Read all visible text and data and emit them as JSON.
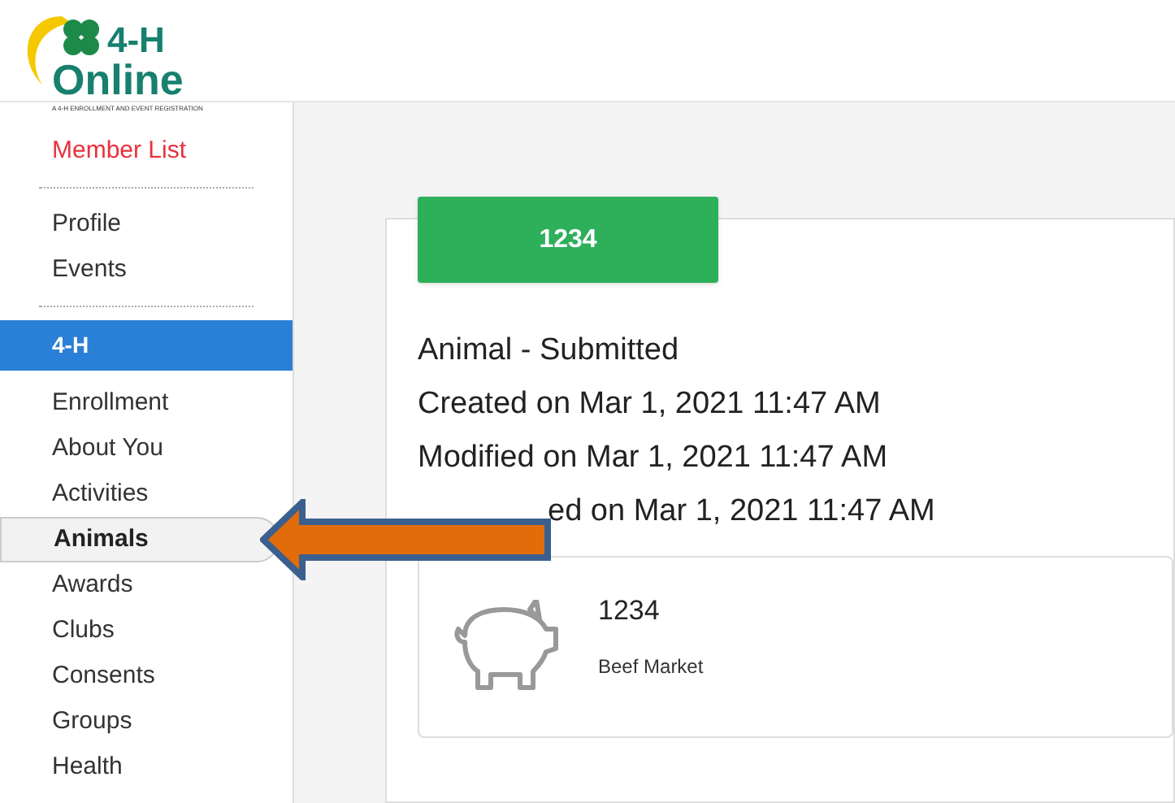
{
  "logo": {
    "line1": "4-H",
    "line2": "Online",
    "tagline": "A 4-H ENROLLMENT AND EVENT REGISTRATION"
  },
  "sidebar": {
    "items": [
      {
        "kind": "link",
        "label": "Member List",
        "selected": false
      },
      {
        "kind": "divider"
      },
      {
        "kind": "item",
        "label": "Profile",
        "selected": false
      },
      {
        "kind": "item",
        "label": "Events",
        "selected": false
      },
      {
        "kind": "divider"
      },
      {
        "kind": "header",
        "label": "4-H"
      },
      {
        "kind": "item",
        "label": "Enrollment",
        "selected": false
      },
      {
        "kind": "item",
        "label": "About You",
        "selected": false
      },
      {
        "kind": "item",
        "label": "Activities",
        "selected": false
      },
      {
        "kind": "item",
        "label": "Animals",
        "selected": true
      },
      {
        "kind": "item",
        "label": "Awards",
        "selected": false
      },
      {
        "kind": "item",
        "label": "Clubs",
        "selected": false
      },
      {
        "kind": "item",
        "label": "Consents",
        "selected": false
      },
      {
        "kind": "item",
        "label": "Groups",
        "selected": false
      },
      {
        "kind": "item",
        "label": "Health",
        "selected": false
      }
    ]
  },
  "animal": {
    "button": "1234",
    "lines": [
      "Animal - Submitted",
      "Created on Mar 1, 2021 11:47 AM",
      "Modified on Mar 1, 2021 11:47 AM",
      "ed on Mar 1, 2021 11:47 AM"
    ],
    "card": {
      "name": "1234",
      "type": "Beef Market"
    }
  }
}
